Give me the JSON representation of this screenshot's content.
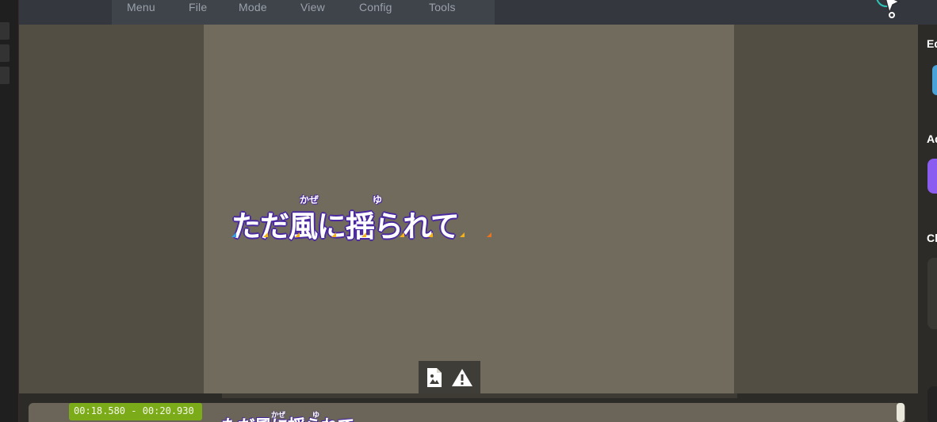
{
  "menu": {
    "items": [
      "Menu",
      "File",
      "Mode",
      "View",
      "Config",
      "Tools"
    ]
  },
  "canvas": {
    "lyric": "ただ風に揺られて",
    "ruby": [
      "かぜ",
      "ゆ"
    ],
    "tools": [
      "image-warning-icon",
      "warning-icon"
    ]
  },
  "sidebar": {
    "headings": [
      "Ed",
      "Ad",
      "Cl"
    ]
  },
  "timeline": {
    "time_range": "00:18.580 - 00:20.930",
    "lyric": "ただ風に揺られて",
    "ruby": [
      "かぜ",
      "ゆ"
    ]
  },
  "colors": {
    "accent_green": "#7cab1a",
    "accent_blue": "#4aa3d8",
    "accent_purple": "#8a5cf0",
    "logo_teal": "#2ec4b6"
  }
}
